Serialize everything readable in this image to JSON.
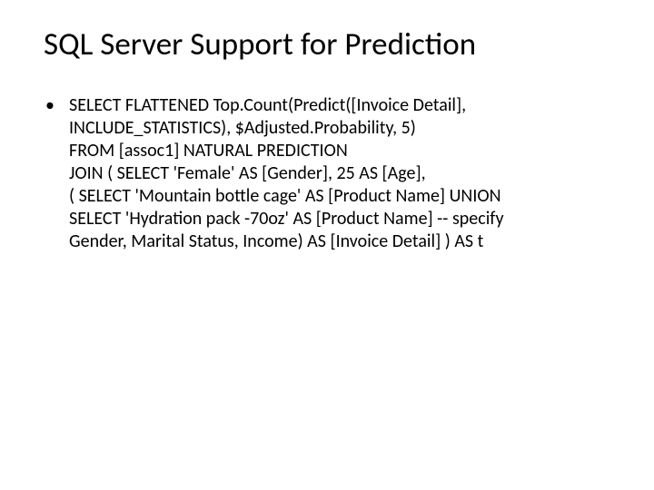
{
  "title": "SQL Server Support for Prediction",
  "bullet": {
    "lines": [
      "SELECT FLATTENED Top.Count(Predict([Invoice Detail],",
      "INCLUDE_STATISTICS), $Adjusted.Probability, 5)",
      "FROM [assoc1] NATURAL PREDICTION",
      "JOIN ( SELECT 'Female' AS [Gender], 25 AS [Age],",
      "( SELECT 'Mountain bottle cage' AS [Product Name] UNION",
      "SELECT 'Hydration pack -70oz' AS [Product Name] -- specify",
      "Gender, Marital Status, Income) AS [Invoice Detail] ) AS t"
    ]
  }
}
